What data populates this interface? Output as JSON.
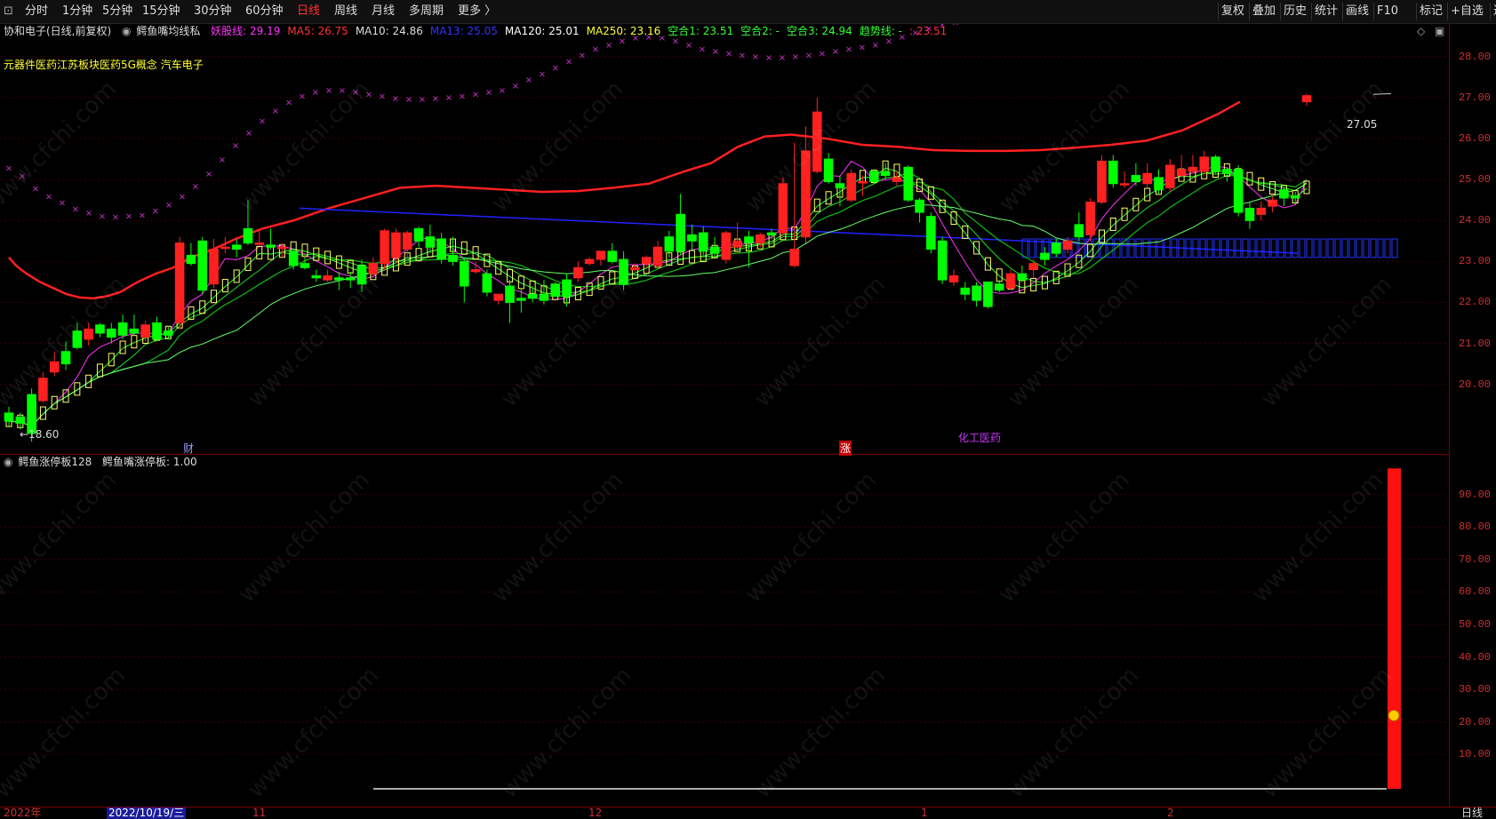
{
  "toolbar": {
    "periods": [
      "分时",
      "1分钟",
      "5分钟",
      "15分钟",
      "30分钟",
      "60分钟",
      "日线",
      "周线",
      "月线",
      "多周期",
      "更多 〉"
    ],
    "active_period": "日线",
    "right_buttons": [
      "复权",
      "叠加",
      "历史",
      "统计",
      "画线",
      "F10",
      "标记",
      "+自选",
      "返回"
    ]
  },
  "header": {
    "stock": "协和电子(日线,前复权)",
    "indicator": "鳄鱼嘴均线私",
    "values": [
      {
        "label": "妖股线: 29.19",
        "color": "#ff33ff"
      },
      {
        "label": "MA5: 26.75",
        "color": "#ff3333"
      },
      {
        "label": "MA10: 24.86",
        "color": "#dddddd"
      },
      {
        "label": "MA13: 25.05",
        "color": "#3333ff"
      },
      {
        "label": "MA120: 25.01",
        "color": "#ffffff"
      },
      {
        "label": "MA250: 23.16",
        "color": "#ffff33"
      },
      {
        "label": "空合1: 23.51",
        "color": "#33ff33"
      },
      {
        "label": "空合2: -",
        "color": "#33ff33"
      },
      {
        "label": "空合3: 24.94",
        "color": "#33ff33"
      },
      {
        "label": "趋势线: -",
        "color": "#33ff33"
      },
      {
        "label": ": 23.51",
        "color": "#ff3333"
      }
    ]
  },
  "concepts": "元器件医药江苏板块医药5G概念 汽车电子",
  "annotations": {
    "low": "←18.60",
    "high": "27.05",
    "finance": "财",
    "limit_up": "涨",
    "sector": "化工医药"
  },
  "price_axis": [
    "28.00",
    "27.00",
    "26.00",
    "25.00",
    "24.00",
    "23.00",
    "22.00",
    "21.00",
    "20.00"
  ],
  "sub_header": {
    "indicator": "鳄鱼涨停板128",
    "value": "鳄鱼嘴涨停板: 1.00"
  },
  "sub_axis": [
    "90.00",
    "80.00",
    "70.00",
    "60.00",
    "50.00",
    "40.00",
    "30.00",
    "20.00",
    "10.00"
  ],
  "date_axis": {
    "year": "2022年",
    "cursor_date": "2022/10/19/三",
    "months": [
      "11",
      "12",
      "1",
      "2"
    ],
    "period_label": "日线"
  },
  "watermark": "www.cfchi.com",
  "colors": {
    "up": "#ff2020",
    "down": "#00ff00",
    "axis": "#d03030",
    "grid": "#3a0000"
  },
  "chart_data": {
    "type": "candlestick",
    "ylim": [
      18.3,
      28.8
    ],
    "candles": [
      [
        19.3,
        19.1,
        19.45,
        18.95
      ],
      [
        19.2,
        19.05,
        19.3,
        18.9
      ],
      [
        19.75,
        18.8,
        19.9,
        18.6
      ],
      [
        19.6,
        20.15,
        19.55,
        20.3
      ],
      [
        20.3,
        20.55,
        20.2,
        20.8
      ],
      [
        20.8,
        20.5,
        21.05,
        20.35
      ],
      [
        21.3,
        20.9,
        21.5,
        20.85
      ],
      [
        21.1,
        21.35,
        20.95,
        21.5
      ],
      [
        21.45,
        21.25,
        21.5,
        21.15
      ],
      [
        21.35,
        21.15,
        21.5,
        21.0
      ],
      [
        21.5,
        21.2,
        21.7,
        21.1
      ],
      [
        21.35,
        21.25,
        21.7,
        21.2
      ],
      [
        21.15,
        21.45,
        21.05,
        21.55
      ],
      [
        21.5,
        21.1,
        21.65,
        21.05
      ],
      [
        21.3,
        21.2,
        21.4,
        21.1
      ],
      [
        21.5,
        23.45,
        21.35,
        23.6
      ],
      [
        23.15,
        22.95,
        23.45,
        22.9
      ],
      [
        23.5,
        22.3,
        23.6,
        22.2
      ],
      [
        22.45,
        23.3,
        22.35,
        23.55
      ],
      [
        23.35,
        23.35,
        23.6,
        23.2
      ],
      [
        23.4,
        23.3,
        23.55,
        23.1
      ],
      [
        23.8,
        23.45,
        24.5,
        23.4
      ],
      [
        23.45,
        23.45,
        23.8,
        23.4
      ],
      [
        23.4,
        23.35,
        23.8,
        23.3
      ],
      [
        23.35,
        23.35,
        23.45,
        23.1
      ],
      [
        23.25,
        22.9,
        23.3,
        22.8
      ],
      [
        22.95,
        22.85,
        23.1,
        22.8
      ],
      [
        22.65,
        22.6,
        22.8,
        22.5
      ],
      [
        22.55,
        22.65,
        22.5,
        22.8
      ],
      [
        22.6,
        22.55,
        22.75,
        22.3
      ],
      [
        22.6,
        22.55,
        22.75,
        22.35
      ],
      [
        22.9,
        22.45,
        23.05,
        22.25
      ],
      [
        22.7,
        22.95,
        22.6,
        23.1
      ],
      [
        22.95,
        23.75,
        22.8,
        23.8
      ],
      [
        23.1,
        23.7,
        22.95,
        23.8
      ],
      [
        23.3,
        23.7,
        23.1,
        23.75
      ],
      [
        23.8,
        23.5,
        23.85,
        23.35
      ],
      [
        23.6,
        23.35,
        23.9,
        23.2
      ],
      [
        23.55,
        23.05,
        23.7,
        22.95
      ],
      [
        23.15,
        23.0,
        23.6,
        22.9
      ],
      [
        23.0,
        22.4,
        23.1,
        22.0
      ],
      [
        22.75,
        22.8,
        23.0,
        22.7
      ],
      [
        22.7,
        22.25,
        22.8,
        22.15
      ],
      [
        22.05,
        22.2,
        21.95,
        22.15
      ],
      [
        22.4,
        22.0,
        22.55,
        21.5
      ],
      [
        22.1,
        22.05,
        22.35,
        21.75
      ],
      [
        22.2,
        22.1,
        22.4,
        22.0
      ],
      [
        22.2,
        22.05,
        22.55,
        21.95
      ],
      [
        22.45,
        22.15,
        22.5,
        22.15
      ],
      [
        22.55,
        22.15,
        22.7,
        21.9
      ],
      [
        22.6,
        22.85,
        22.5,
        23.0
      ],
      [
        22.95,
        23.05,
        22.9,
        23.1
      ],
      [
        23.05,
        23.25,
        22.9,
        23.25
      ],
      [
        23.25,
        23.0,
        23.45,
        22.95
      ],
      [
        23.05,
        22.45,
        23.25,
        22.3
      ],
      [
        22.8,
        22.85,
        22.75,
        22.95
      ],
      [
        22.95,
        23.1,
        22.85,
        23.15
      ],
      [
        22.9,
        23.35,
        22.85,
        23.5
      ],
      [
        23.6,
        23.25,
        23.75,
        23.1
      ],
      [
        24.15,
        23.25,
        24.65,
        23.15
      ],
      [
        23.65,
        23.5,
        23.9,
        23.25
      ],
      [
        23.7,
        23.25,
        23.85,
        23.1
      ],
      [
        23.35,
        23.2,
        23.6,
        23.1
      ],
      [
        23.05,
        23.7,
        22.95,
        23.75
      ],
      [
        23.35,
        23.5,
        23.25,
        23.95
      ],
      [
        23.6,
        23.45,
        23.75,
        22.85
      ],
      [
        23.45,
        23.65,
        23.35,
        23.7
      ],
      [
        23.7,
        23.65,
        23.8,
        23.55
      ],
      [
        23.7,
        24.9,
        23.6,
        25.05
      ],
      [
        22.9,
        23.3,
        22.85,
        25.9
      ],
      [
        23.6,
        25.7,
        23.45,
        26.3
      ],
      [
        25.2,
        26.65,
        25.15,
        27.0
      ],
      [
        25.5,
        24.95,
        25.65,
        24.9
      ],
      [
        24.9,
        24.8,
        25.1,
        24.35
      ],
      [
        24.5,
        25.15,
        24.45,
        25.25
      ],
      [
        24.95,
        24.95,
        25.1,
        24.6
      ],
      [
        25.2,
        24.95,
        25.25,
        24.9
      ],
      [
        25.2,
        25.1,
        25.4,
        25.0
      ],
      [
        24.95,
        25.05,
        24.85,
        25.2
      ],
      [
        25.3,
        24.5,
        25.35,
        24.45
      ],
      [
        24.5,
        24.2,
        24.55,
        23.95
      ],
      [
        24.1,
        23.3,
        24.2,
        23.2
      ],
      [
        23.5,
        22.55,
        23.6,
        22.45
      ],
      [
        22.5,
        22.65,
        22.4,
        22.8
      ],
      [
        22.35,
        22.2,
        22.5,
        22.05
      ],
      [
        22.4,
        22.05,
        22.5,
        21.9
      ],
      [
        22.5,
        21.9,
        22.5,
        21.85
      ],
      [
        22.45,
        22.3,
        22.55,
        22.25
      ],
      [
        22.35,
        22.7,
        22.3,
        22.8
      ],
      [
        22.7,
        22.55,
        22.9,
        22.5
      ],
      [
        22.8,
        22.95,
        22.6,
        23.05
      ],
      [
        23.2,
        23.05,
        23.35,
        22.9
      ],
      [
        23.45,
        23.2,
        23.55,
        23.1
      ],
      [
        23.3,
        23.5,
        23.2,
        23.6
      ],
      [
        23.9,
        23.6,
        24.2,
        23.5
      ],
      [
        23.65,
        24.45,
        23.5,
        24.55
      ],
      [
        24.45,
        25.45,
        24.4,
        25.6
      ],
      [
        25.45,
        24.9,
        25.6,
        24.8
      ],
      [
        24.9,
        24.9,
        25.2,
        24.8
      ],
      [
        25.1,
        24.95,
        25.4,
        24.85
      ],
      [
        24.9,
        25.15,
        24.8,
        25.4
      ],
      [
        25.05,
        24.75,
        25.25,
        24.65
      ],
      [
        24.8,
        25.35,
        24.7,
        25.5
      ],
      [
        25.1,
        25.25,
        25.05,
        25.6
      ],
      [
        25.2,
        25.3,
        25.15,
        25.6
      ],
      [
        25.2,
        25.55,
        25.1,
        25.7
      ],
      [
        25.55,
        25.2,
        25.6,
        25.15
      ],
      [
        25.25,
        25.15,
        25.3,
        24.95
      ],
      [
        25.25,
        24.2,
        25.35,
        24.1
      ],
      [
        24.3,
        24.0,
        24.45,
        23.8
      ],
      [
        24.15,
        24.3,
        24.0,
        24.45
      ],
      [
        24.35,
        24.5,
        24.2,
        24.6
      ],
      [
        24.75,
        24.55,
        24.8,
        24.35
      ],
      [
        24.6,
        24.55,
        24.7,
        24.4
      ],
      [
        26.9,
        27.05,
        26.8,
        27.1
      ]
    ],
    "ma_red": [
      23.1,
      22.9,
      22.7,
      22.5,
      22.35,
      22.2,
      22.12,
      22.1,
      22.15,
      22.25,
      22.5,
      22.7,
      22.85,
      23.1,
      23.3,
      23.55,
      23.8,
      24.0,
      24.3,
      24.55,
      24.8,
      24.85,
      24.8,
      24.75,
      24.7,
      24.72,
      24.8,
      24.9,
      25.2,
      25.4,
      25.8,
      26.05,
      26.1,
      26.0,
      25.85,
      25.8,
      25.72,
      25.7,
      25.7,
      25.72,
      25.78,
      25.85,
      25.95,
      26.2,
      26.6,
      26.9
    ],
    "ma_red_x": [
      0,
      8,
      20,
      35,
      50,
      65,
      80,
      95,
      110,
      125,
      145,
      165,
      185,
      205,
      230,
      255,
      285,
      320,
      360,
      400,
      440,
      480,
      520,
      560,
      600,
      640,
      680,
      720,
      760,
      790,
      820,
      850,
      880,
      920,
      960,
      1000,
      1040,
      1080,
      1120,
      1160,
      1200,
      1240,
      1280,
      1320,
      1360,
      1385
    ],
    "blue_line": [
      [
        337,
        24.3
      ],
      [
        1460,
        23.2
      ]
    ],
    "parabolic_x": [
      0,
      15,
      30,
      45,
      60,
      75,
      90,
      105,
      120,
      135,
      150,
      165,
      180,
      195,
      210,
      225,
      240,
      255,
      270,
      285,
      300,
      315,
      330,
      345,
      360,
      375,
      390,
      405,
      420,
      435,
      450,
      465,
      480,
      495,
      510,
      525,
      540,
      555,
      570,
      585,
      600,
      615,
      630,
      645,
      660,
      675,
      690,
      705,
      720,
      735,
      750,
      765,
      780,
      795,
      810,
      825,
      840,
      855,
      870,
      885,
      900,
      915,
      930,
      945,
      960,
      975,
      990,
      1005,
      1020,
      1035,
      1050,
      1065,
      1080,
      1095,
      1110,
      1125,
      1140,
      1155,
      1170,
      1185,
      1200,
      1215,
      1230,
      1245,
      1260,
      1275,
      1290,
      1305,
      1320,
      1335,
      1350,
      1365,
      1380,
      1395,
      1410,
      1425,
      1440,
      1455
    ],
    "parabolic_y": [
      25.3,
      25.1,
      24.8,
      24.6,
      24.45,
      24.3,
      24.2,
      24.12,
      24.1,
      24.12,
      24.15,
      24.25,
      24.4,
      24.6,
      24.85,
      25.15,
      25.5,
      25.85,
      26.15,
      26.45,
      26.7,
      26.9,
      27.05,
      27.15,
      27.2,
      27.2,
      27.15,
      27.1,
      27.05,
      27.0,
      26.98,
      26.98,
      27.0,
      27.02,
      27.05,
      27.1,
      27.15,
      27.2,
      27.3,
      27.45,
      27.6,
      27.75,
      27.9,
      28.05,
      28.2,
      28.3,
      28.4,
      28.48,
      28.5,
      28.48,
      28.4,
      28.3,
      28.2,
      28.15,
      28.1,
      28.05,
      28.02,
      28.0,
      28.0,
      28.02,
      28.05,
      28.1,
      28.15,
      28.2,
      28.25,
      28.3,
      28.4,
      28.5,
      28.6,
      28.7,
      28.8,
      28.85,
      28.9,
      29.0
    ],
    "limit_up_bar": {
      "value": 98,
      "ylim": [
        0,
        100
      ]
    }
  }
}
